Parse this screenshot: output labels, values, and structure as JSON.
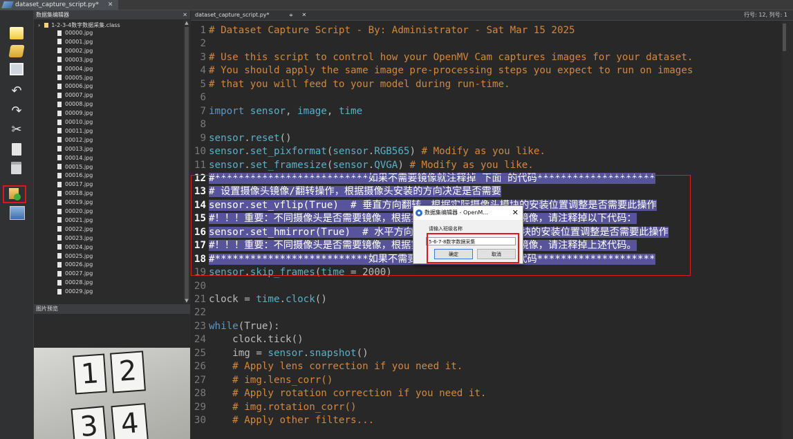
{
  "window": {
    "tab_title": "dataset_capture_script.py*",
    "close_glyph": "✕"
  },
  "toolbar": {
    "icons": [
      "new-file-icon",
      "open-folder-icon",
      "save-icon",
      "undo-icon",
      "redo-icon",
      "cut-icon",
      "copy-icon",
      "paste-icon",
      "dataset-editor-icon",
      "screenshot-icon"
    ],
    "redo_glyph": "↷",
    "undo_glyph": "↶",
    "cut_glyph": "✂"
  },
  "file_tree": {
    "header": "数据集编辑器",
    "close_glyph": "✕",
    "root": "1-2-3-4数字数据采集.class",
    "files": [
      "00000.jpg",
      "00001.jpg",
      "00002.jpg",
      "00003.jpg",
      "00004.jpg",
      "00005.jpg",
      "00006.jpg",
      "00007.jpg",
      "00008.jpg",
      "00009.jpg",
      "00010.jpg",
      "00011.jpg",
      "00012.jpg",
      "00013.jpg",
      "00014.jpg",
      "00015.jpg",
      "00016.jpg",
      "00017.jpg",
      "00018.jpg",
      "00019.jpg",
      "00020.jpg",
      "00021.jpg",
      "00022.jpg",
      "00023.jpg",
      "00024.jpg",
      "00025.jpg",
      "00026.jpg",
      "00027.jpg",
      "00028.jpg",
      "00029.jpg"
    ]
  },
  "preview": {
    "header": "图片预览",
    "digits": [
      "1",
      "2",
      "3",
      "4"
    ]
  },
  "editor": {
    "tab_label": "dataset_capture_script.py*",
    "tab_chevron": "≑",
    "tab_close": "✕",
    "cursor_position": "行号: 12, 列号: 1",
    "selection_accent": "#58549c"
  },
  "code_lines": [
    {
      "n": "1",
      "segs": [
        {
          "c": "cm",
          "t": "# Dataset Capture Script - By: Administrator - Sat Mar 15 2025"
        }
      ]
    },
    {
      "n": "2",
      "segs": []
    },
    {
      "n": "3",
      "segs": [
        {
          "c": "cm",
          "t": "# Use this script to control how your OpenMV Cam captures images for your dataset."
        }
      ]
    },
    {
      "n": "4",
      "segs": [
        {
          "c": "cm",
          "t": "# You should apply the same image pre-processing steps you expect to run on images"
        }
      ]
    },
    {
      "n": "5",
      "segs": [
        {
          "c": "cm",
          "t": "# that you will feed to your model during run-time."
        }
      ]
    },
    {
      "n": "6",
      "segs": []
    },
    {
      "n": "7",
      "segs": [
        {
          "c": "kw",
          "t": "import"
        },
        {
          "c": "nm",
          "t": " sensor"
        },
        {
          "c": "txt",
          "t": ", "
        },
        {
          "c": "nm",
          "t": "image"
        },
        {
          "c": "txt",
          "t": ", "
        },
        {
          "c": "nm",
          "t": "time"
        }
      ]
    },
    {
      "n": "8",
      "segs": []
    },
    {
      "n": "9",
      "segs": [
        {
          "c": "nm",
          "t": "sensor"
        },
        {
          "c": "txt",
          "t": "."
        },
        {
          "c": "nm",
          "t": "reset"
        },
        {
          "c": "txt",
          "t": "()"
        }
      ]
    },
    {
      "n": "10",
      "segs": [
        {
          "c": "nm",
          "t": "sensor"
        },
        {
          "c": "txt",
          "t": "."
        },
        {
          "c": "nm",
          "t": "set_pixformat"
        },
        {
          "c": "txt",
          "t": "("
        },
        {
          "c": "nm",
          "t": "sensor"
        },
        {
          "c": "txt",
          "t": "."
        },
        {
          "c": "nm",
          "t": "RGB565"
        },
        {
          "c": "txt",
          "t": ") "
        },
        {
          "c": "cm",
          "t": "# Modify as you like."
        }
      ]
    },
    {
      "n": "11",
      "segs": [
        {
          "c": "nm",
          "t": "sensor"
        },
        {
          "c": "txt",
          "t": "."
        },
        {
          "c": "nm",
          "t": "set_framesize"
        },
        {
          "c": "txt",
          "t": "("
        },
        {
          "c": "nm",
          "t": "sensor"
        },
        {
          "c": "txt",
          "t": "."
        },
        {
          "c": "nm",
          "t": "QVGA"
        },
        {
          "c": "txt",
          "t": ") "
        },
        {
          "c": "cm",
          "t": "# Modify as you like."
        }
      ]
    },
    {
      "n": "12",
      "sel": true,
      "segs": [
        {
          "c": "selbg",
          "t": "#**************************如果不需要镜像就注释掉 下面 的代码********************"
        }
      ]
    },
    {
      "n": "13",
      "sel": true,
      "segs": [
        {
          "c": "selbg",
          "t": "# 设置摄像头镜像/翻转操作，根据摄像头安装的方向决定是否需要"
        }
      ]
    },
    {
      "n": "14",
      "sel": true,
      "segs": [
        {
          "c": "selbg",
          "t": "sensor.set_vflip(True)  # 垂直方向翻转，根据实际摄像头模块的安装位置调整是否需要此操作"
        }
      ]
    },
    {
      "n": "15",
      "sel": true,
      "segs": [
        {
          "c": "selbg",
          "t": "#！！！重要：不同摄像头是否需要镜像，根据实际情况决定，若不需要镜像，请注释掉以下代码："
        }
      ]
    },
    {
      "n": "16",
      "sel": true,
      "segs": [
        {
          "c": "selbg",
          "t": "sensor.set_hmirror(True)  # 水平方向翻转，根据实际摄像头模块的安装位置调整是否需要此操作"
        }
      ]
    },
    {
      "n": "17",
      "sel": true,
      "segs": [
        {
          "c": "selbg",
          "t": "#！！！重要：不同摄像头是否需要镜像，根据实际情况决定，若不需要镜像，请注释掉上述代码。"
        }
      ]
    },
    {
      "n": "18",
      "sel": true,
      "segs": [
        {
          "c": "selbg",
          "t": "#**************************如果不需要镜像就注释掉 上面 的代码********************"
        }
      ]
    },
    {
      "n": "19",
      "segs": [
        {
          "c": "nm",
          "t": "sensor"
        },
        {
          "c": "txt",
          "t": "."
        },
        {
          "c": "nm",
          "t": "skip_frames"
        },
        {
          "c": "txt",
          "t": "("
        },
        {
          "c": "nm",
          "t": "time"
        },
        {
          "c": "txt",
          "t": " = 2000)"
        }
      ]
    },
    {
      "n": "20",
      "segs": []
    },
    {
      "n": "21",
      "segs": [
        {
          "c": "txt",
          "t": "clock = "
        },
        {
          "c": "nm",
          "t": "time"
        },
        {
          "c": "txt",
          "t": "."
        },
        {
          "c": "nm",
          "t": "clock"
        },
        {
          "c": "txt",
          "t": "()"
        }
      ]
    },
    {
      "n": "22",
      "segs": []
    },
    {
      "n": "23",
      "segs": [
        {
          "c": "kw",
          "t": "while"
        },
        {
          "c": "txt",
          "t": "(True):"
        }
      ]
    },
    {
      "n": "24",
      "segs": [
        {
          "c": "txt",
          "t": "    clock.tick()"
        }
      ]
    },
    {
      "n": "25",
      "segs": [
        {
          "c": "txt",
          "t": "    img = "
        },
        {
          "c": "nm",
          "t": "sensor"
        },
        {
          "c": "txt",
          "t": "."
        },
        {
          "c": "nm",
          "t": "snapshot"
        },
        {
          "c": "txt",
          "t": "()"
        }
      ]
    },
    {
      "n": "26",
      "segs": [
        {
          "c": "cm",
          "t": "    # Apply lens correction if you need it."
        }
      ]
    },
    {
      "n": "27",
      "segs": [
        {
          "c": "cm",
          "t": "    # img.lens_corr()"
        }
      ]
    },
    {
      "n": "28",
      "segs": [
        {
          "c": "cm",
          "t": "    # Apply rotation correction if you need it."
        }
      ]
    },
    {
      "n": "29",
      "segs": [
        {
          "c": "cm",
          "t": "    # img.rotation_corr()"
        }
      ]
    },
    {
      "n": "30",
      "segs": [
        {
          "c": "cm",
          "t": "    # Apply other filters..."
        }
      ]
    }
  ],
  "dialog": {
    "title": "数据集编辑器 - OpenM...",
    "close_glyph": "✕",
    "prompt": "请输入班级名称",
    "input_value": "5-6-7-8数字数据采集",
    "ok_label": "确定",
    "cancel_label": "取消"
  }
}
